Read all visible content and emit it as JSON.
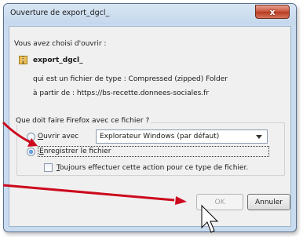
{
  "window": {
    "title": "Ouverture de export_dgcl_",
    "close_label": "x"
  },
  "file": {
    "intro": "Vous avez choisi d'ouvrir :",
    "name": "export_dgcl_",
    "type_line": "qui est un fichier de type : Compressed (zipped) Folder",
    "source_line": "à partir de : https://bs-recette.donnees-sociales.fr",
    "icon": "folder-zip-icon"
  },
  "action": {
    "question": "Que doit faire Firefox avec ce fichier ?",
    "open_with_label": "Ouvrir avec",
    "open_with_selected": "Explorateur Windows (par défaut)",
    "save_label": "Enregistrer le fichier",
    "always_label": "Toujours effectuer cette action pour ce type de fichier.",
    "selected": "save"
  },
  "buttons": {
    "ok": "OK",
    "cancel": "Annuler"
  },
  "colors": {
    "annotation_arrow": "#cc0a1e",
    "close_button": "#c7523a"
  }
}
